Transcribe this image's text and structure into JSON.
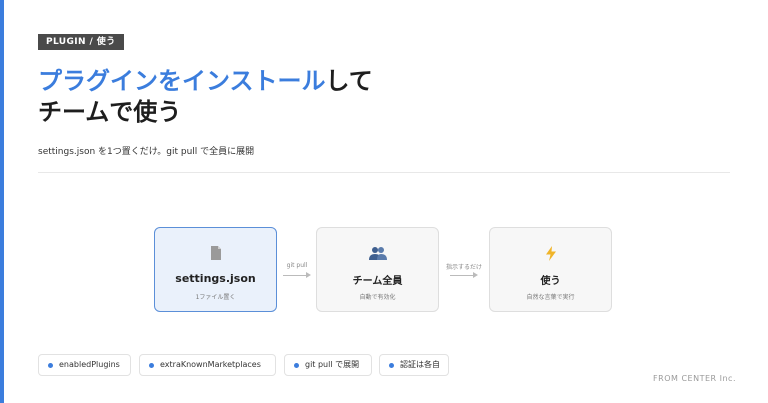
{
  "tag": "PLUGIN / 使う",
  "title": {
    "highlight": "プラグインをインストール",
    "line1_rest": "して",
    "line2": "チームで使う"
  },
  "subtitle": "settings.json を1つ置くだけ。git pull で全員に展開",
  "flow": {
    "cards": [
      {
        "icon": "document-icon",
        "glyph": "▗",
        "name": "settings.json",
        "desc": "1ファイル置く",
        "active": true
      },
      {
        "icon": "team-icon",
        "glyph": "👥",
        "name": "チーム全員",
        "desc": "自動で有効化",
        "active": false
      },
      {
        "icon": "lightning-icon",
        "glyph": "⚡",
        "name": "使う",
        "desc": "自然な言葉で実行",
        "active": false
      }
    ],
    "arrows": [
      {
        "label": "git pull"
      },
      {
        "label": "指示するだけ"
      }
    ]
  },
  "chips": [
    {
      "label": "enabledPlugins"
    },
    {
      "label": "extraKnownMarketplaces"
    },
    {
      "label": "git pull で展開"
    },
    {
      "label": "認証は各自"
    }
  ],
  "footer": "FROM CENTER Inc.",
  "colors": {
    "accent": "#3b7ddd",
    "tag_bg": "#4a4a4a",
    "active_card_bg": "#eaf1fb",
    "active_card_border": "#5b8fd8",
    "icon_team": "#3f5f8f",
    "icon_lightning": "#f0b429"
  }
}
